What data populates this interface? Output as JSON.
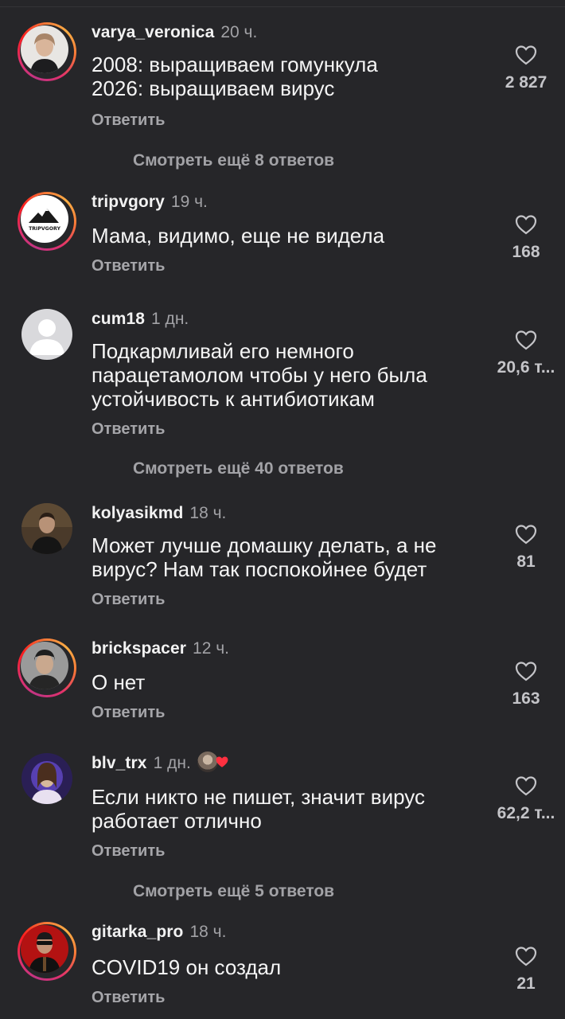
{
  "reply_label": "Ответить",
  "comments": [
    {
      "username": "varya_veronica",
      "time": "20 ч.",
      "lines": [
        "2008: выращиваем гомункула",
        "2026: выращиваем вирус"
      ],
      "likes": "2 827",
      "more_replies": "Смотреть ещё 8 ответов"
    },
    {
      "username": "tripvgory",
      "time": "19 ч.",
      "lines": [
        "Мама, видимо, еще не видела"
      ],
      "likes": "168",
      "avatar_logo_text": "TRIPVGORY"
    },
    {
      "username": "cum18",
      "time": "1 дн.",
      "lines": [
        "Подкармливай его немного",
        "парацетамолом чтобы у него была",
        "устойчивость к антибиотикам"
      ],
      "likes": "20,6 т...",
      "more_replies": "Смотреть ещё 40 ответов"
    },
    {
      "username": "kolyasikmd",
      "time": "18 ч.",
      "lines": [
        "Может лучше домашку делать, а не",
        "вирус? Нам так поспокойнее будет"
      ],
      "likes": "81"
    },
    {
      "username": "brickspacer",
      "time": "12 ч.",
      "lines": [
        "О нет"
      ],
      "likes": "163"
    },
    {
      "username": "blv_trx",
      "time": "1 дн.",
      "lines": [
        "Если никто не пишет, значит вирус",
        "работает отлично"
      ],
      "likes": "62,2 т...",
      "more_replies": "Смотреть ещё 5 ответов"
    },
    {
      "username": "gitarka_pro",
      "time": "18 ч.",
      "lines": [
        "COVID19 он создал"
      ],
      "likes": "21"
    }
  ],
  "colors": {
    "background": "#262629",
    "text": "#f5f5f5",
    "muted": "#a2a2a6",
    "author_like_heart": "#ff3040"
  }
}
